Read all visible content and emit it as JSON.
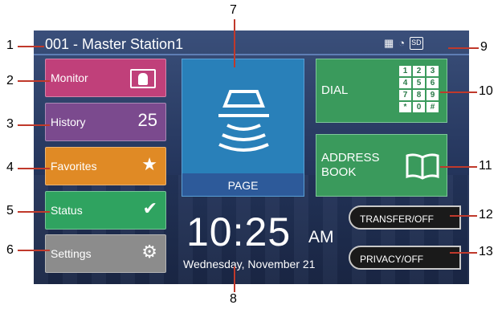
{
  "header": {
    "station_title": "001 - Master Station1"
  },
  "buttons": {
    "monitor": "Monitor",
    "history": "History",
    "history_count": "25",
    "favorites": "Favorites",
    "status": "Status",
    "settings": "Settings",
    "page": "PAGE",
    "dial": "DIAL",
    "address_line1": "ADDRESS",
    "address_line2": "BOOK",
    "transfer": "TRANSFER/OFF",
    "privacy": "PRIVACY/OFF"
  },
  "keypad": [
    "1",
    "2",
    "3",
    "4",
    "5",
    "6",
    "7",
    "8",
    "9",
    "*",
    "0",
    "#"
  ],
  "clock": {
    "time": "10:25",
    "ampm": "AM",
    "date": "Wednesday, November 21"
  },
  "status_icons": {
    "sd": "SD"
  },
  "callouts": [
    "1",
    "2",
    "3",
    "4",
    "5",
    "6",
    "7",
    "8",
    "9",
    "10",
    "11",
    "12",
    "13"
  ],
  "colors": {
    "monitor": "#c0407a",
    "history": "#7b4a8e",
    "favorites": "#e08a25",
    "status": "#2fa360",
    "settings": "#8c8c8c",
    "page": "#2980b9",
    "dial": "#3a9a5c",
    "callout_line": "#c0392b"
  }
}
